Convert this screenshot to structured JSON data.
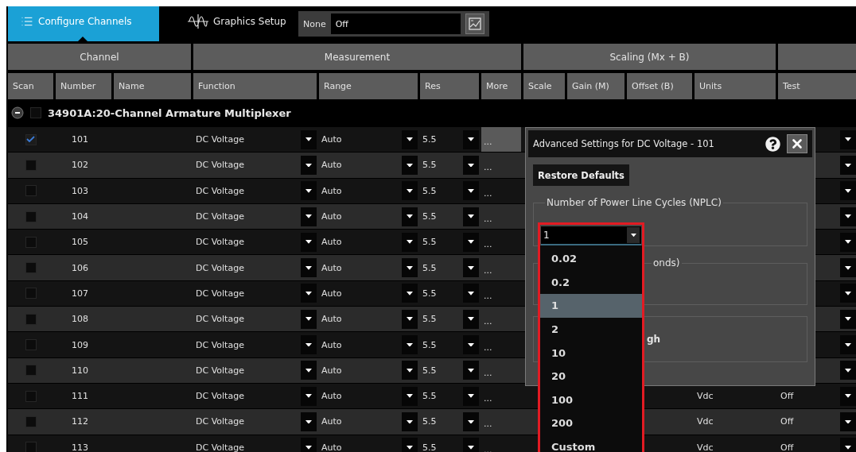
{
  "tabs": [
    {
      "label": "Configure Channels",
      "selected": true
    },
    {
      "label": "Graphics Setup",
      "selected": false
    }
  ],
  "toolbar": {
    "label": "None",
    "value": "Off"
  },
  "header_groups": [
    {
      "label": "Channel",
      "columns": [
        "Scan",
        "Number",
        "Name"
      ]
    },
    {
      "label": "Measurement",
      "columns": [
        "Function",
        "Range",
        "Res",
        "More"
      ]
    },
    {
      "label": "Scaling (Mx + B)",
      "columns": [
        "Scale",
        "Gain (M)",
        "Offset (B)",
        "Units"
      ]
    },
    {
      "columns": [
        "Test"
      ]
    }
  ],
  "module": {
    "title": "34901A:20-Channel Armature Multiplexer",
    "expanded": true,
    "checked": false
  },
  "rows": [
    {
      "number": "101",
      "scan": true,
      "function": "DC Voltage",
      "range": "Auto",
      "res": "5.5",
      "more": "...",
      "more_open": true
    },
    {
      "number": "102",
      "scan": false,
      "function": "DC Voltage",
      "range": "Auto",
      "res": "5.5",
      "more": "...",
      "more_open": false
    },
    {
      "number": "103",
      "scan": false,
      "function": "DC Voltage",
      "range": "Auto",
      "res": "5.5",
      "more": "...",
      "more_open": false
    },
    {
      "number": "104",
      "scan": false,
      "function": "DC Voltage",
      "range": "Auto",
      "res": "5.5",
      "more": "...",
      "more_open": false
    },
    {
      "number": "105",
      "scan": false,
      "function": "DC Voltage",
      "range": "Auto",
      "res": "5.5",
      "more": "...",
      "more_open": false
    },
    {
      "number": "106",
      "scan": false,
      "function": "DC Voltage",
      "range": "Auto",
      "res": "5.5",
      "more": "...",
      "more_open": false
    },
    {
      "number": "107",
      "scan": false,
      "function": "DC Voltage",
      "range": "Auto",
      "res": "5.5",
      "more": "...",
      "more_open": false
    },
    {
      "number": "108",
      "scan": false,
      "function": "DC Voltage",
      "range": "Auto",
      "res": "5.5",
      "more": "...",
      "more_open": false
    },
    {
      "number": "109",
      "scan": false,
      "function": "DC Voltage",
      "range": "Auto",
      "res": "5.5",
      "more": "...",
      "more_open": false
    },
    {
      "number": "110",
      "scan": false,
      "function": "DC Voltage",
      "range": "Auto",
      "res": "5.5",
      "more": "...",
      "more_open": false
    },
    {
      "number": "111",
      "scan": false,
      "function": "DC Voltage",
      "range": "Auto",
      "res": "5.5",
      "more": "...",
      "more_open": false,
      "units": "Vdc",
      "test": "Off"
    },
    {
      "number": "112",
      "scan": false,
      "function": "DC Voltage",
      "range": "Auto",
      "res": "5.5",
      "more": "...",
      "more_open": false,
      "units": "Vdc",
      "test": "Off"
    },
    {
      "number": "113",
      "scan": false,
      "function": "DC Voltage",
      "range": "Auto",
      "res": "5.5",
      "more": "...",
      "more_open": false,
      "units": "Vdc",
      "test": "Off"
    }
  ],
  "dialog": {
    "title": "Advanced Settings for DC Voltage - 101",
    "restore_button": "Restore Defaults",
    "sections": [
      {
        "legend": "Number of Power Line Cycles (NPLC)"
      },
      {
        "legend": "onds)"
      },
      {
        "text": "gh"
      }
    ],
    "select": {
      "value": "1",
      "expanded": true,
      "highlighted": true,
      "options": [
        {
          "label": "0.02",
          "selected": false
        },
        {
          "label": "0.2",
          "selected": false
        },
        {
          "label": "1",
          "selected": true
        },
        {
          "label": "2",
          "selected": false
        },
        {
          "label": "10",
          "selected": false
        },
        {
          "label": "20",
          "selected": false
        },
        {
          "label": "100",
          "selected": false
        },
        {
          "label": "200",
          "selected": false
        },
        {
          "label": "Custom",
          "selected": false
        }
      ]
    }
  }
}
